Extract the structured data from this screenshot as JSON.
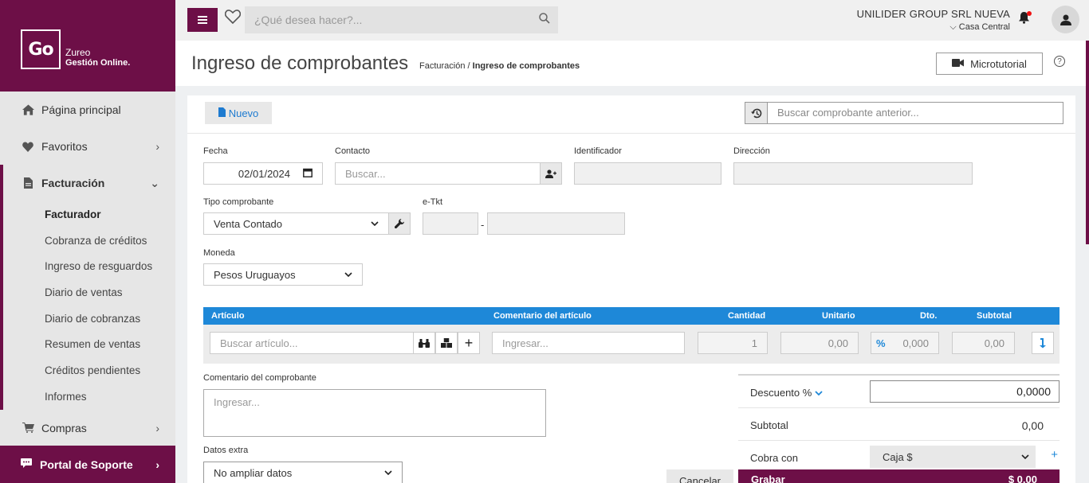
{
  "brand": {
    "logo": "Go",
    "line1": "Zureo",
    "line2": "Gestión Online."
  },
  "sidebar": {
    "items": [
      {
        "label": "Página principal",
        "icon": "home-icon"
      },
      {
        "label": "Favoritos",
        "icon": "heart-icon"
      }
    ],
    "section": {
      "label": "Facturación",
      "icon": "document-icon"
    },
    "sub_items": [
      {
        "label": "Facturador",
        "active": true
      },
      {
        "label": "Cobranza de créditos"
      },
      {
        "label": "Ingreso de resguardos"
      },
      {
        "label": "Diario de ventas"
      },
      {
        "label": "Diario de cobranzas"
      },
      {
        "label": "Resumen de ventas"
      },
      {
        "label": "Créditos pendientes"
      },
      {
        "label": "Informes"
      }
    ],
    "compras": {
      "label": "Compras",
      "icon": "cart-icon"
    },
    "portal": {
      "label": "Portal de Soporte",
      "icon": "chat-icon"
    }
  },
  "topbar": {
    "search_placeholder": "¿Qué desea hacer?...",
    "company": "UNILIDER GROUP SRL NUEVA",
    "branch": "Casa Central"
  },
  "header": {
    "title": "Ingreso de comprobantes",
    "crumb_parent": "Facturación",
    "crumb_current": "Ingreso de comprobantes",
    "micro_label": "Microtutorial",
    "help": "?"
  },
  "toolbar": {
    "nuevo_label": "Nuevo",
    "prev_search_placeholder": "Buscar comprobante anterior..."
  },
  "form": {
    "fecha_label": "Fecha",
    "fecha_value": "02/01/2024",
    "contacto_label": "Contacto",
    "contacto_placeholder": "Buscar...",
    "identificador_label": "Identificador",
    "direccion_label": "Dirección",
    "tipo_label": "Tipo comprobante",
    "tipo_value": "Venta Contado",
    "etkt_label": "e-Tkt",
    "etkt_sep": "-",
    "moneda_label": "Moneda",
    "moneda_value": "Pesos Uruguayos"
  },
  "table": {
    "headers": {
      "articulo": "Artículo",
      "comentario": "Comentario del artículo",
      "cantidad": "Cantidad",
      "unitario": "Unitario",
      "dto": "Dto.",
      "subtotal": "Subtotal"
    },
    "row": {
      "articulo_placeholder": "Buscar artículo...",
      "comentario_placeholder": "Ingresar...",
      "cantidad": "1",
      "unitario": "0,00",
      "dto_symbol": "%",
      "dto": "0,000",
      "subtotal": "0,00"
    }
  },
  "comment": {
    "label": "Comentario del comprobante",
    "placeholder": "Ingresar..."
  },
  "extra": {
    "label": "Datos extra",
    "value": "No ampliar datos"
  },
  "totals": {
    "descuento_label": "Descuento %",
    "descuento_value": "0,0000",
    "subtotal_label": "Subtotal",
    "subtotal_value": "0,00",
    "cobra_label": "Cobra con",
    "cobra_value": "Caja $"
  },
  "actions": {
    "cancel_label": "Cancelar",
    "grabar_label": "Grabar",
    "grabar_amount": "$ 0,00"
  },
  "colors": {
    "brand": "#6d0f47",
    "accent": "#1e88d8"
  }
}
